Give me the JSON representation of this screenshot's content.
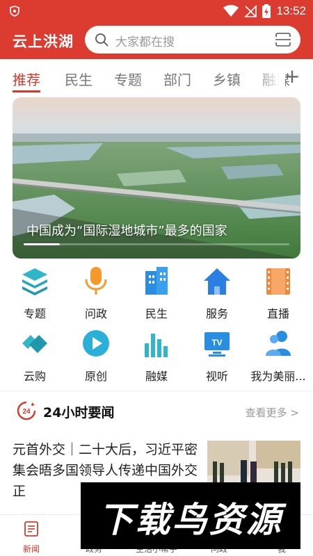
{
  "colors": {
    "brand": "#dc3c2f",
    "accent": "#d23a2e"
  },
  "status_bar": {
    "time": "13:52"
  },
  "header": {
    "title": "云上洪湖",
    "search": {
      "placeholder": "大家都在搜",
      "icon": "search-icon",
      "scan_icon": "scan-icon"
    }
  },
  "tabs": [
    "推荐",
    "民生",
    "专题",
    "部门",
    "乡镇",
    "融媒"
  ],
  "tab_add_label": "+",
  "banner": {
    "caption": "中国成为“国际湿地城市”最多的国家"
  },
  "grid": [
    {
      "label": "专题",
      "icon": "layers-icon"
    },
    {
      "label": "问政",
      "icon": "microphone-icon"
    },
    {
      "label": "民生",
      "icon": "building-icon"
    },
    {
      "label": "服务",
      "icon": "home-icon"
    },
    {
      "label": "直播",
      "icon": "film-icon"
    },
    {
      "label": "云购",
      "icon": "handshake-icon"
    },
    {
      "label": "原创",
      "icon": "play-icon"
    },
    {
      "label": "融媒",
      "icon": "bar-chart-icon"
    },
    {
      "label": "视听",
      "icon": "tv-icon"
    },
    {
      "label": "我为美丽...",
      "icon": "users-icon"
    }
  ],
  "news_section": {
    "logo_text": "24",
    "title": "24小时要闻",
    "more": "查看更多 >"
  },
  "article": {
    "title": "元首外交｜二十大后，习近平密集会晤多国领导人传递中国外交正"
  },
  "watermark": {
    "text": "下载鸟资源"
  },
  "bottom_nav": [
    {
      "label": "新闻",
      "icon": "news-icon",
      "active": true
    },
    {
      "label": "政务",
      "icon": "government-icon"
    },
    {
      "label": "生活小帮手",
      "icon": "helper-icon"
    },
    {
      "label": "问政",
      "icon": "question-icon"
    },
    {
      "label": "我",
      "icon": "user-icon"
    }
  ]
}
